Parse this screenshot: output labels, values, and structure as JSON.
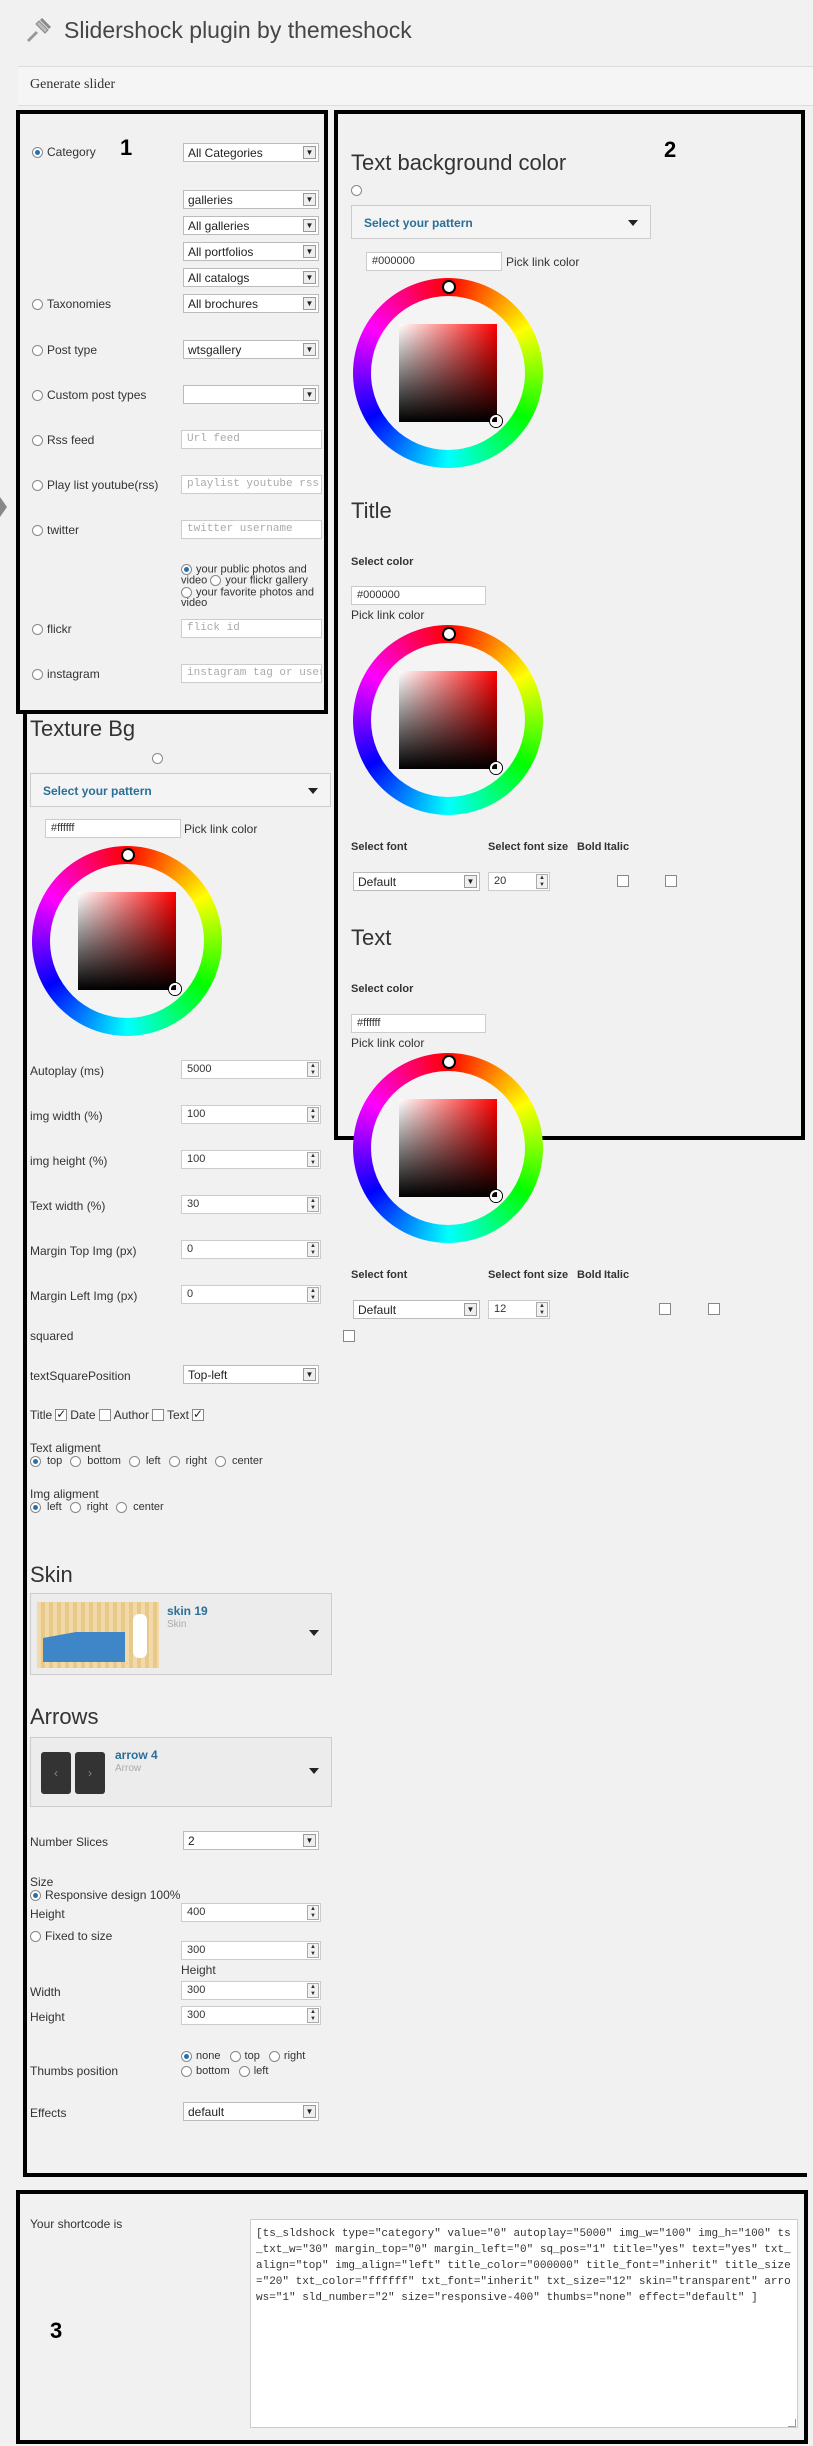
{
  "page": {
    "title": "Slidershock plugin by themeshock",
    "generate_label": "Generate slider"
  },
  "markers": {
    "one": "1",
    "two": "2",
    "three": "3"
  },
  "sources": {
    "category_label": "Category",
    "category_select": "All Categories",
    "sub_selects": [
      "galleries",
      "All galleries",
      "All portfolios",
      "All catalogs"
    ],
    "taxonomies_label": "Taxonomies",
    "taxonomies_select": "All brochures",
    "post_type_label": "Post type",
    "post_type_select": "wtsgallery",
    "custom_post_types_label": "Custom post types",
    "rss_label": "Rss feed",
    "rss_placeholder": "Url feed",
    "playlist_label": "Play list youtube(rss)",
    "playlist_placeholder": "playlist youtube rss",
    "twitter_label": "twitter",
    "twitter_placeholder": "twitter username",
    "flickr_opt1": "your public photos and video",
    "flickr_opt2": "your flickr gallery",
    "flickr_opt3": "your favorite photos and video",
    "flickr_label": "flickr",
    "flickr_placeholder": "flick id",
    "instagram_label": "instagram",
    "instagram_placeholder": "instagram tag or user"
  },
  "text_bg": {
    "heading": "Text background color",
    "pattern_label": "Select your pattern",
    "color_value": "#000000",
    "pick_label": "Pick link color"
  },
  "title_section": {
    "heading": "Title",
    "select_color": "Select color",
    "color_value": "#000000",
    "pick_label": "Pick link color",
    "font_label": "Select font",
    "size_label": "Select font size",
    "bold_label": "Bold",
    "italic_label": "Italic",
    "font_value": "Default",
    "size_value": "20"
  },
  "text_section": {
    "heading": "Text",
    "select_color": "Select color",
    "color_value": "#ffffff",
    "pick_label": "Pick link color",
    "font_label": "Select font",
    "size_label": "Select font size",
    "bold_label": "Bold",
    "italic_label": "Italic",
    "font_value": "Default",
    "size_value": "12"
  },
  "texture": {
    "heading": "Texture Bg",
    "pattern_label": "Select your pattern",
    "color_value": "#ffffff",
    "pick_label": "Pick link color"
  },
  "fields": {
    "autoplay_label": "Autoplay (ms)",
    "autoplay_value": "5000",
    "imgw_label": "img width (%)",
    "imgw_value": "100",
    "imgh_label": "img height (%)",
    "imgh_value": "100",
    "textw_label": "Text width (%)",
    "textw_value": "30",
    "mtop_label": "Margin Top Img (px)",
    "mtop_value": "0",
    "mleft_label": "Margin Left Img (px)",
    "mleft_value": "0",
    "squared_label": "squared",
    "tsp_label": "textSquarePosition",
    "tsp_value": "Top-left",
    "show_title": "Title",
    "show_date": "Date",
    "show_author": "Author",
    "show_text": "Text",
    "text_align_label": "Text aligment",
    "text_align_opts": [
      "top",
      "bottom",
      "left",
      "right",
      "center"
    ],
    "img_align_label": "Img aligment",
    "img_align_opts": [
      "left",
      "right",
      "center"
    ]
  },
  "skin": {
    "heading": "Skin",
    "name": "skin 19",
    "sub": "Skin"
  },
  "arrows": {
    "heading": "Arrows",
    "name": "arrow 4",
    "sub": "Arrow"
  },
  "slices": {
    "label": "Number Slices",
    "value": "2"
  },
  "size": {
    "label": "Size",
    "responsive_label": "Responsive design 100%",
    "height_label": "Height",
    "height_value": "400",
    "fixed_label": "Fixed to size",
    "fixed_value": "300",
    "fixed_sub": "Height",
    "width_label": "Width",
    "width_value": "300",
    "height2_label": "Height",
    "height2_value": "300"
  },
  "thumbs": {
    "label": "Thumbs position",
    "opts": [
      "none",
      "top",
      "right",
      "bottom",
      "left"
    ]
  },
  "effects": {
    "label": "Effects",
    "value": "default"
  },
  "shortcode": {
    "label": "Your shortcode is",
    "code": "[ts_sldshock type=\"category\" value=\"0\" autoplay=\"5000\" img_w=\"100\" img_h=\"100\" ts_txt_w=\"30\" margin_top=\"0\" margin_left=\"0\" sq_pos=\"1\" title=\"yes\" text=\"yes\" txt_align=\"top\" img_align=\"left\" title_color=\"000000\" title_font=\"inherit\" title_size=\"20\" txt_color=\"ffffff\" txt_font=\"inherit\" txt_size=\"12\" skin=\"transparent\" arrows=\"1\" sld_number=\"2\" size=\"responsive-400\" thumbs=\"none\" effect=\"default\" ]"
  }
}
